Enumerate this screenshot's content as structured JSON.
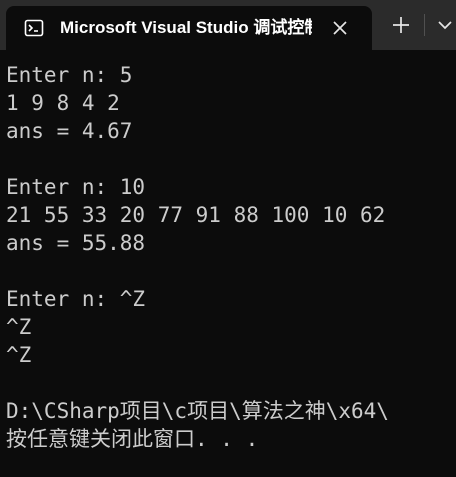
{
  "window": {
    "tab_title": "Microsoft Visual Studio 调试控制台"
  },
  "icons": {
    "tab_icon": "console-icon",
    "close": "close-icon",
    "new_tab": "plus-icon",
    "dropdown": "chevron-down-icon"
  },
  "colors": {
    "background": "#0c0c0c",
    "titlebar": "#2b2b2b",
    "text": "#cccccc"
  },
  "console": {
    "lines": [
      "Enter n: 5",
      "1 9 8 4 2",
      "ans = 4.67",
      "",
      "Enter n: 10",
      "21 55 33 20 77 91 88 100 10 62",
      "ans = 55.88",
      "",
      "Enter n: ^Z",
      "^Z",
      "^Z",
      "",
      "D:\\CSharp项目\\c项目\\算法之神\\x64\\",
      "按任意键关闭此窗口. . ."
    ]
  }
}
